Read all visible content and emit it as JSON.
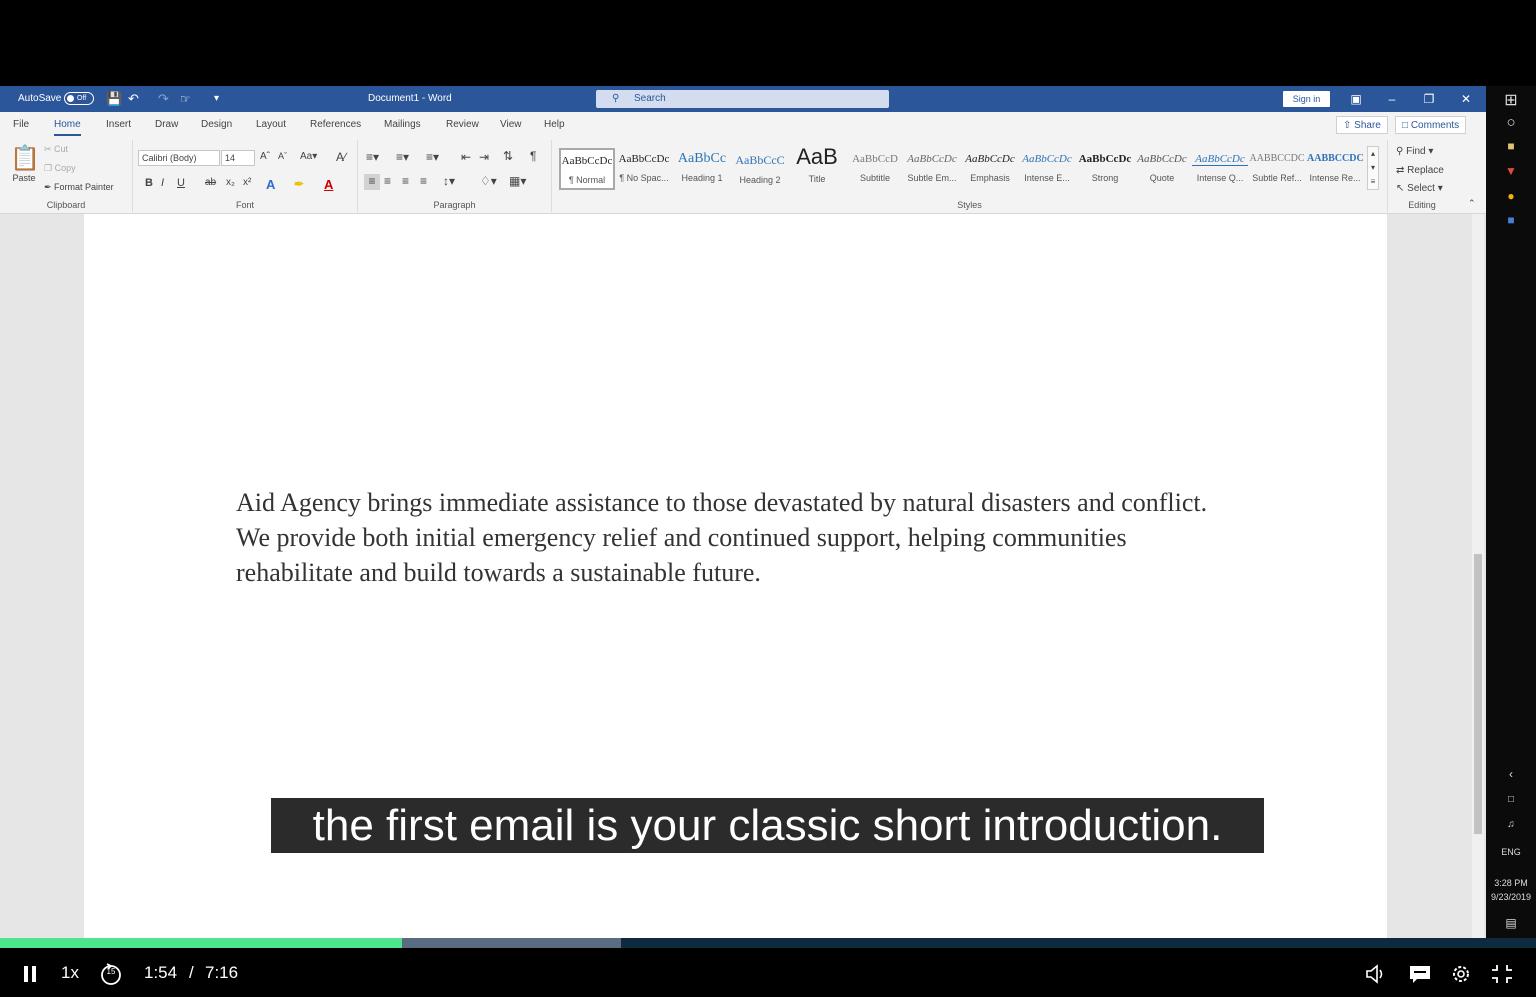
{
  "titlebar": {
    "autosave_label": "AutoSave",
    "autosave_state": "Off",
    "document_title": "Document1 - Word",
    "search_placeholder": "Search",
    "sign_in": "Sign in"
  },
  "tabs": [
    "File",
    "Home",
    "Insert",
    "Draw",
    "Design",
    "Layout",
    "References",
    "Mailings",
    "Review",
    "View",
    "Help"
  ],
  "active_tab": "Home",
  "share_label": "Share",
  "comments_label": "Comments",
  "clipboard": {
    "paste": "Paste",
    "cut": "Cut",
    "copy": "Copy",
    "format_painter": "Format Painter",
    "group_label": "Clipboard"
  },
  "font": {
    "name": "Calibri (Body)",
    "size": "14",
    "group_label": "Font"
  },
  "paragraph": {
    "group_label": "Paragraph"
  },
  "styles": {
    "group_label": "Styles",
    "items": [
      {
        "sample": "AaBbCcDc",
        "name": "¶ Normal"
      },
      {
        "sample": "AaBbCcDc",
        "name": "¶ No Spac..."
      },
      {
        "sample": "AaBbCc",
        "name": "Heading 1"
      },
      {
        "sample": "AaBbCcC",
        "name": "Heading 2"
      },
      {
        "sample": "AaB",
        "name": "Title"
      },
      {
        "sample": "AaBbCcD",
        "name": "Subtitle"
      },
      {
        "sample": "AaBbCcDc",
        "name": "Subtle Em..."
      },
      {
        "sample": "AaBbCcDc",
        "name": "Emphasis"
      },
      {
        "sample": "AaBbCcDc",
        "name": "Intense E..."
      },
      {
        "sample": "AaBbCcDc",
        "name": "Strong"
      },
      {
        "sample": "AaBbCcDc",
        "name": "Quote"
      },
      {
        "sample": "AaBbCcDc",
        "name": "Intense Q..."
      },
      {
        "sample": "AABBCCDC",
        "name": "Subtle Ref..."
      },
      {
        "sample": "AABBCCDC",
        "name": "Intense Re..."
      }
    ]
  },
  "editing": {
    "find": "Find",
    "replace": "Replace",
    "select": "Select",
    "group_label": "Editing"
  },
  "document": {
    "body": "Aid Agency brings immediate assistance to those devastated by natural disasters and conflict. We provide both initial emergency relief and continued support, helping communities rehabilitate and build towards a sustainable future."
  },
  "taskbar": {
    "language": "ENG",
    "time": "3:28 PM",
    "date": "9/23/2019"
  },
  "subtitle": "the first email is your classic short introduction.",
  "player": {
    "speed": "1x",
    "skip_back": "15",
    "current_time": "1:54",
    "separator": "/",
    "duration": "7:16",
    "played_fraction": 0.262,
    "buffered_fraction": 0.404
  }
}
